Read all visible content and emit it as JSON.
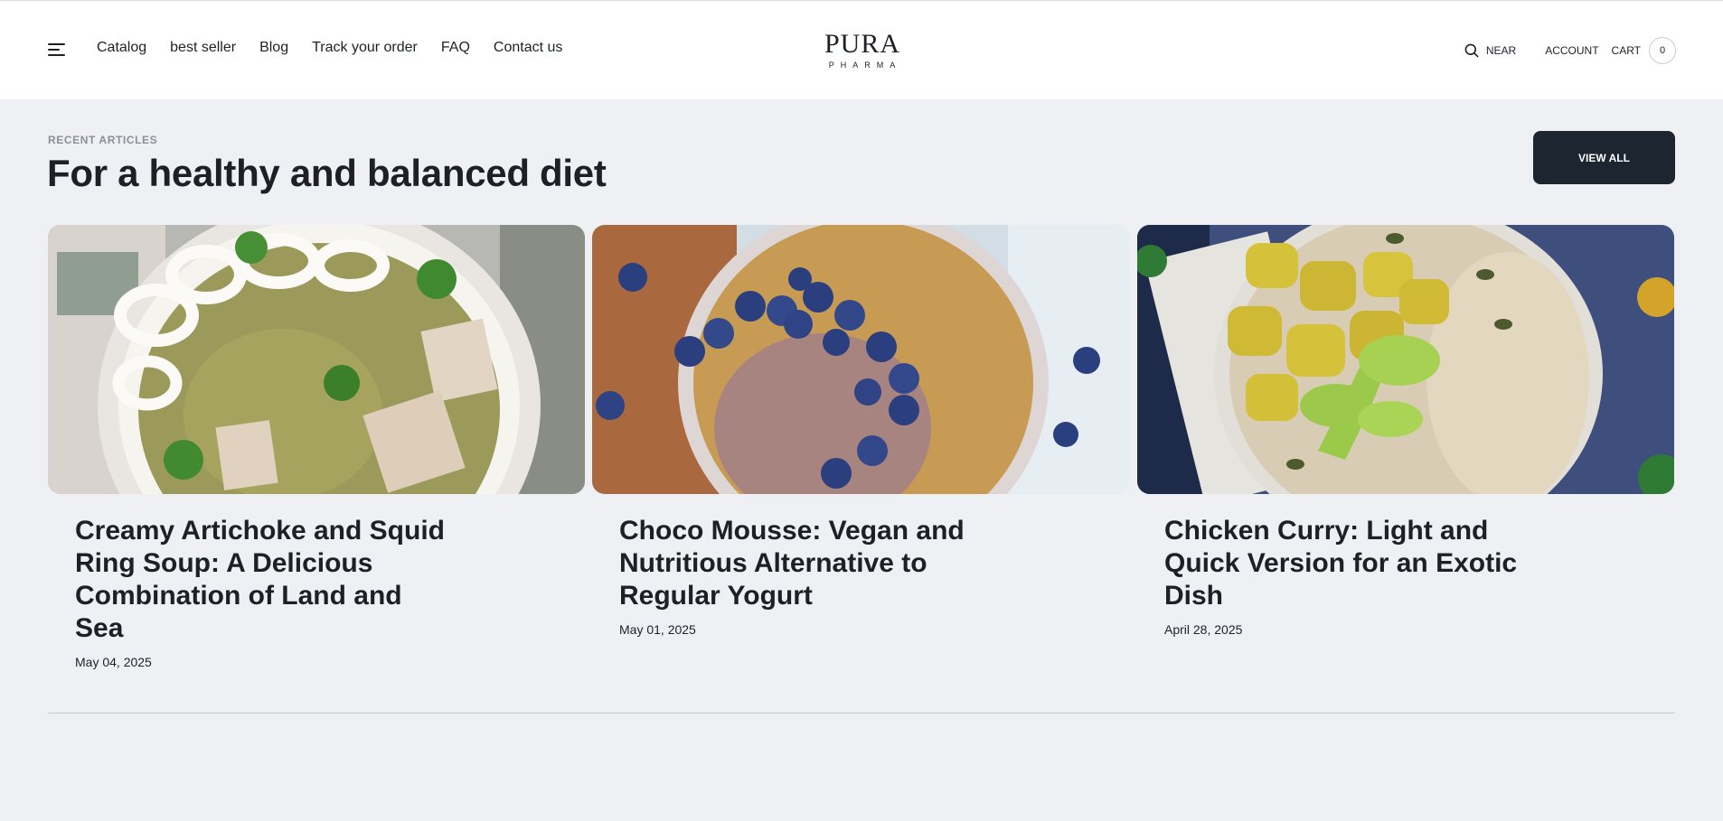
{
  "header": {
    "nav": [
      "Catalog",
      "best seller",
      "Blog",
      "Track your order",
      "FAQ",
      "Contact us"
    ],
    "logo": {
      "main": "PURA",
      "sub": "PHARMA"
    },
    "near_label": "NEAR",
    "account_label": "ACCOUNT",
    "cart_label": "CART",
    "cart_count": "0"
  },
  "section": {
    "eyebrow": "RECENT ARTICLES",
    "title": "For a healthy and balanced diet",
    "view_all_label": "VIEW ALL"
  },
  "articles": [
    {
      "title": "Creamy Artichoke and Squid Ring Soup: A Delicious Combination of Land and Sea",
      "date": "May 04, 2025",
      "image": "artichoke-squid-soup-photo"
    },
    {
      "title": "Choco Mousse: Vegan and Nutritious Alternative to Regular Yogurt",
      "date": "May 01, 2025",
      "image": "choco-mousse-blueberry-bowl-photo"
    },
    {
      "title": "Chicken Curry: Light and Quick Version for an Exotic Dish",
      "date": "April 28, 2025",
      "image": "chicken-curry-rice-bowl-photo"
    }
  ],
  "colors": {
    "page_bg": "#eff0f4",
    "header_bg": "#ffffff",
    "text": "#1d2127",
    "button_bg": "#1d2630",
    "muted": "#8c9099"
  }
}
